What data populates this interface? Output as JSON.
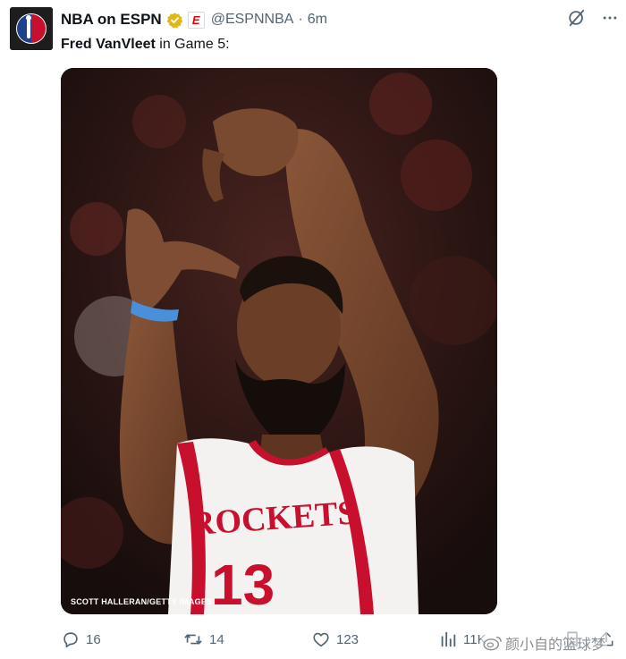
{
  "post": {
    "author_name": "NBA on ESPN",
    "affiliate_badge": "E",
    "handle": "@ESPNNBA",
    "separator": "·",
    "time": "6m",
    "text_name": "Fred VanVleet",
    "text_rest": " in Game 5:"
  },
  "media": {
    "credit": "SCOTT HALLERAN/GETTY IMAGES",
    "jersey_team": "ROCKETS",
    "jersey_number": "13"
  },
  "actions": {
    "replies": "16",
    "reposts": "14",
    "likes": "123",
    "views": "11K"
  },
  "watermark": {
    "text": "颜小自的篮球梦"
  },
  "colors": {
    "verified_gold": "#e2b719",
    "espn_red": "#d50a0a",
    "jersey_red": "#c8102e",
    "icon_gray": "#536471"
  },
  "icons": {
    "reply": "reply-icon",
    "repost": "repost-icon",
    "like": "like-icon",
    "views": "views-icon",
    "grok": "grok-icon",
    "verified": "verified-badge-icon"
  }
}
